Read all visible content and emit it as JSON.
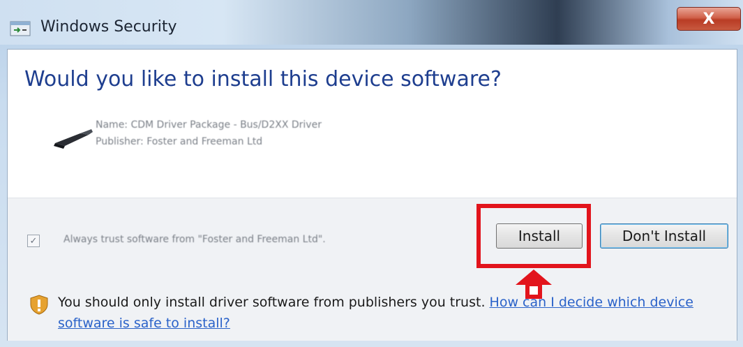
{
  "window": {
    "title": "Windows Security",
    "close_label": "X"
  },
  "main": {
    "heading": "Would you like to install this device software?",
    "package_name": "Name: CDM Driver Package - Bus/D2XX Driver",
    "publisher": "Publisher: Foster and Freeman Ltd"
  },
  "footer": {
    "trust_label": "Always trust software from \"Foster and Freeman Ltd\".",
    "install_label": "Install",
    "dont_install_label": "Don't Install",
    "warning_text": "You should only install driver software from publishers you trust.",
    "help_link": "How can I decide which device software is safe to install?"
  },
  "colors": {
    "heading": "#1e3e8f",
    "highlight": "#e2141c",
    "link": "#2a62c9"
  },
  "icons": [
    "app-icon",
    "usb-device-icon",
    "checkbox-check-icon",
    "up-arrow-icon",
    "shield-warning-icon"
  ]
}
